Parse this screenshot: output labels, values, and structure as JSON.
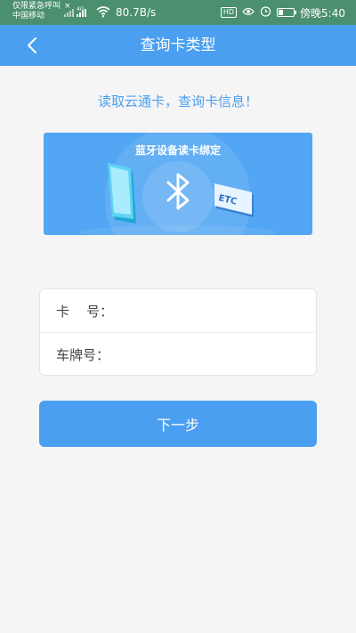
{
  "status_bar": {
    "emergency_text": "仅限紧急呼叫",
    "close_glyph": "×",
    "carrier": "中国移动",
    "network_type": "4G",
    "speed": "80.7B/s",
    "hd_badge": "HD",
    "time": "傍晚5:40",
    "icons": [
      "signal-icon",
      "wifi-icon",
      "eye-icon",
      "alarm-icon",
      "battery-icon"
    ]
  },
  "nav": {
    "title": "查询卡类型",
    "back_icon": "chevron-left-icon"
  },
  "subtitle": "读取云通卡，查询卡信息！",
  "banner": {
    "title": "蓝牙设备读卡绑定",
    "card_text": "ETC",
    "icons": [
      "phone-icon",
      "bluetooth-icon",
      "etc-card-icon"
    ]
  },
  "form": {
    "card_number_label": "卡    号：",
    "plate_number_label": "车牌号：",
    "card_number_value": "",
    "plate_number_value": ""
  },
  "next_button_label": "下一步",
  "colors": {
    "primary": "#4a9ff0",
    "status_bar": "#4a8f6e",
    "background": "#f5f5f5"
  }
}
